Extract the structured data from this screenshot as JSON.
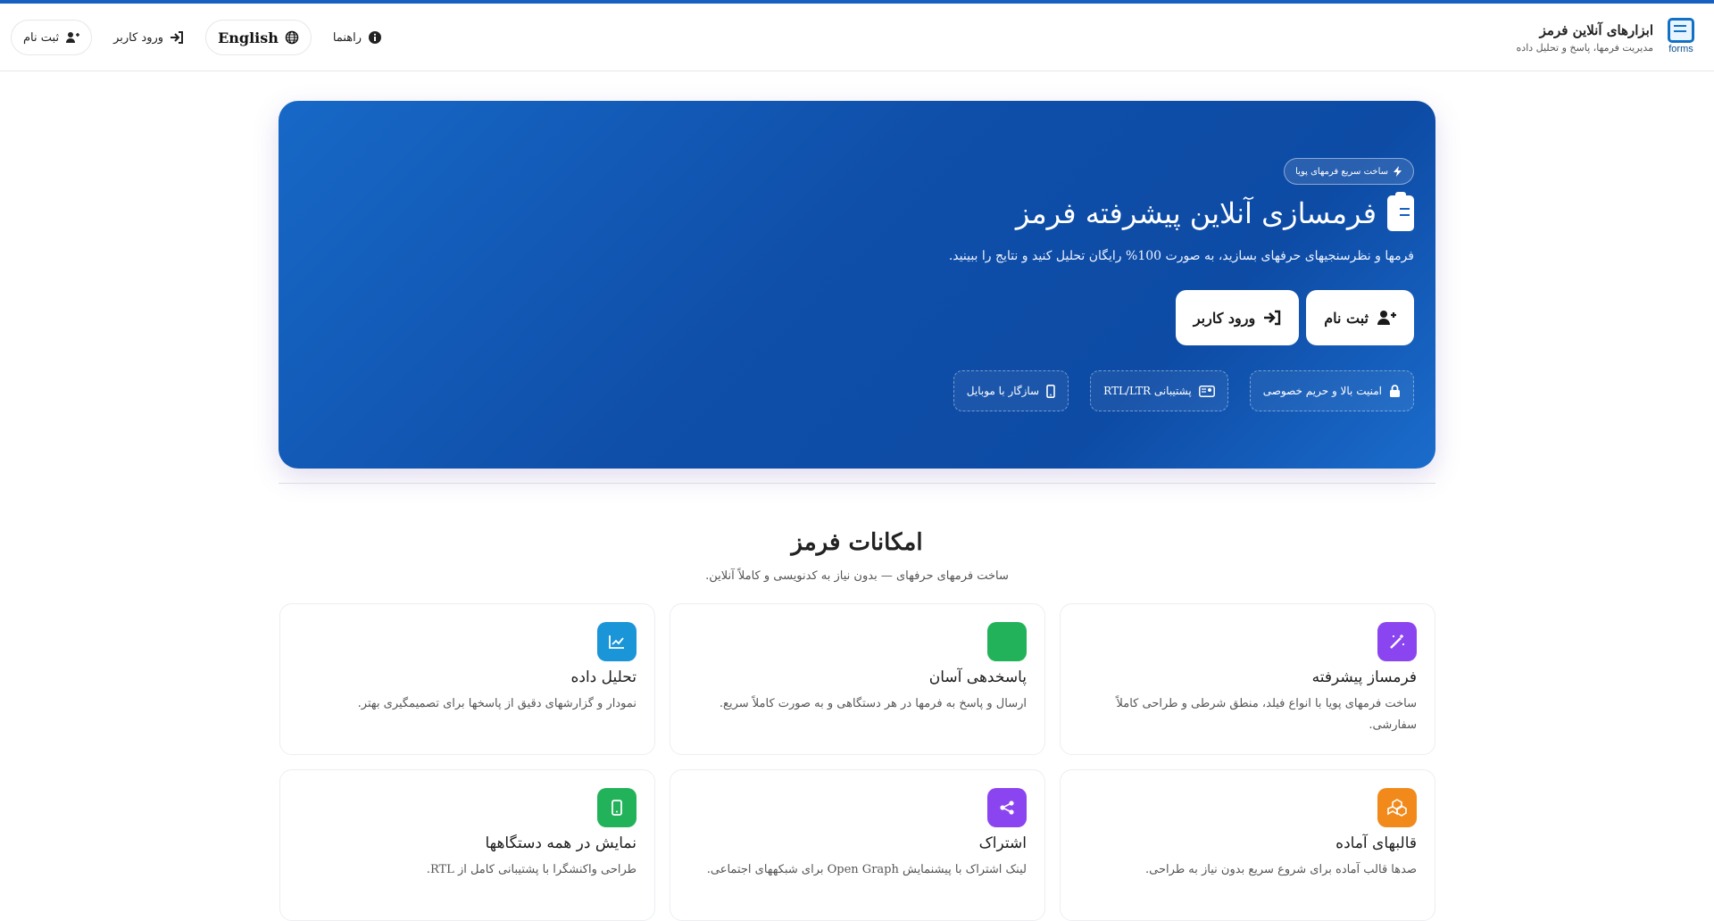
{
  "brand": {
    "title": "ابزارهای آنلاین فرمز",
    "subtitle": "مدیریت فرمها، پاسخ و تحلیل داده",
    "logo_label": "forms"
  },
  "nav": [
    {
      "label": "راهنما",
      "icon": "info-icon"
    },
    {
      "label": "English",
      "icon": "globe-icon"
    },
    {
      "label": "ورود کاربر",
      "icon": "sign-in-icon"
    },
    {
      "label": "ثبت نام",
      "icon": "user-plus-icon"
    }
  ],
  "hero": {
    "badge": "ساخت سریع فرمهای پویا",
    "title": "فرمسازی آنلاین پیشرفته فرمز",
    "description": "فرمها و نظرسنجیهای حرفهای بسازید، به صورت 100% رایگان تحلیل کنید و نتایج را ببینید.",
    "register_label": "ثبت نام",
    "login_label": "ورود کاربر",
    "chips": [
      {
        "label": "امنیت بالا و حریم خصوصی",
        "icon": "lock-icon"
      },
      {
        "label": "پشتیبانی RTL/LTR",
        "icon": "id-card-icon"
      },
      {
        "label": "سازگار با موبایل",
        "icon": "mobile-icon"
      }
    ]
  },
  "section": {
    "title": "امکانات فرمز",
    "subtitle": "ساخت فرمهای حرفهای — بدون نیاز به کدنویسی و کاملاً آنلاین."
  },
  "features": [
    {
      "title": "فرمساز پیشرفته",
      "desc": "ساخت فرمهای پویا با انواع فیلد، منطق شرطی و طراحی کاملاً سفارشی.",
      "color": "#8b45f0",
      "icon": "wand-icon"
    },
    {
      "title": "پاسخدهی آسان",
      "desc": "ارسال و پاسخ به فرمها در هر دستگاهی و به صورت کاملاً سریع.",
      "color": "#22b35a",
      "icon": "check-icon"
    },
    {
      "title": "تحلیل داده",
      "desc": "نمودار و گزارشهای دقیق از پاسخها برای تصمیمگیری بهتر.",
      "color": "#1a95d8",
      "icon": "chart-line-icon"
    },
    {
      "title": "قالبهای آماده",
      "desc": "صدها قالب آماده برای شروع سریع بدون نیاز به طراحی.",
      "color": "#f18a1b",
      "icon": "cubes-icon"
    },
    {
      "title": "اشتراک",
      "desc": "لینک اشتراک با پیشنمایش Open Graph برای شبکههای اجتماعی.",
      "color": "#8b45f0",
      "icon": "share-icon"
    },
    {
      "title": "نمایش در همه دستگاهها",
      "desc": "طراحی واکنشگرا با پشتیبانی کامل از RTL.",
      "color": "#22b35a",
      "icon": "mobile-icon"
    }
  ]
}
